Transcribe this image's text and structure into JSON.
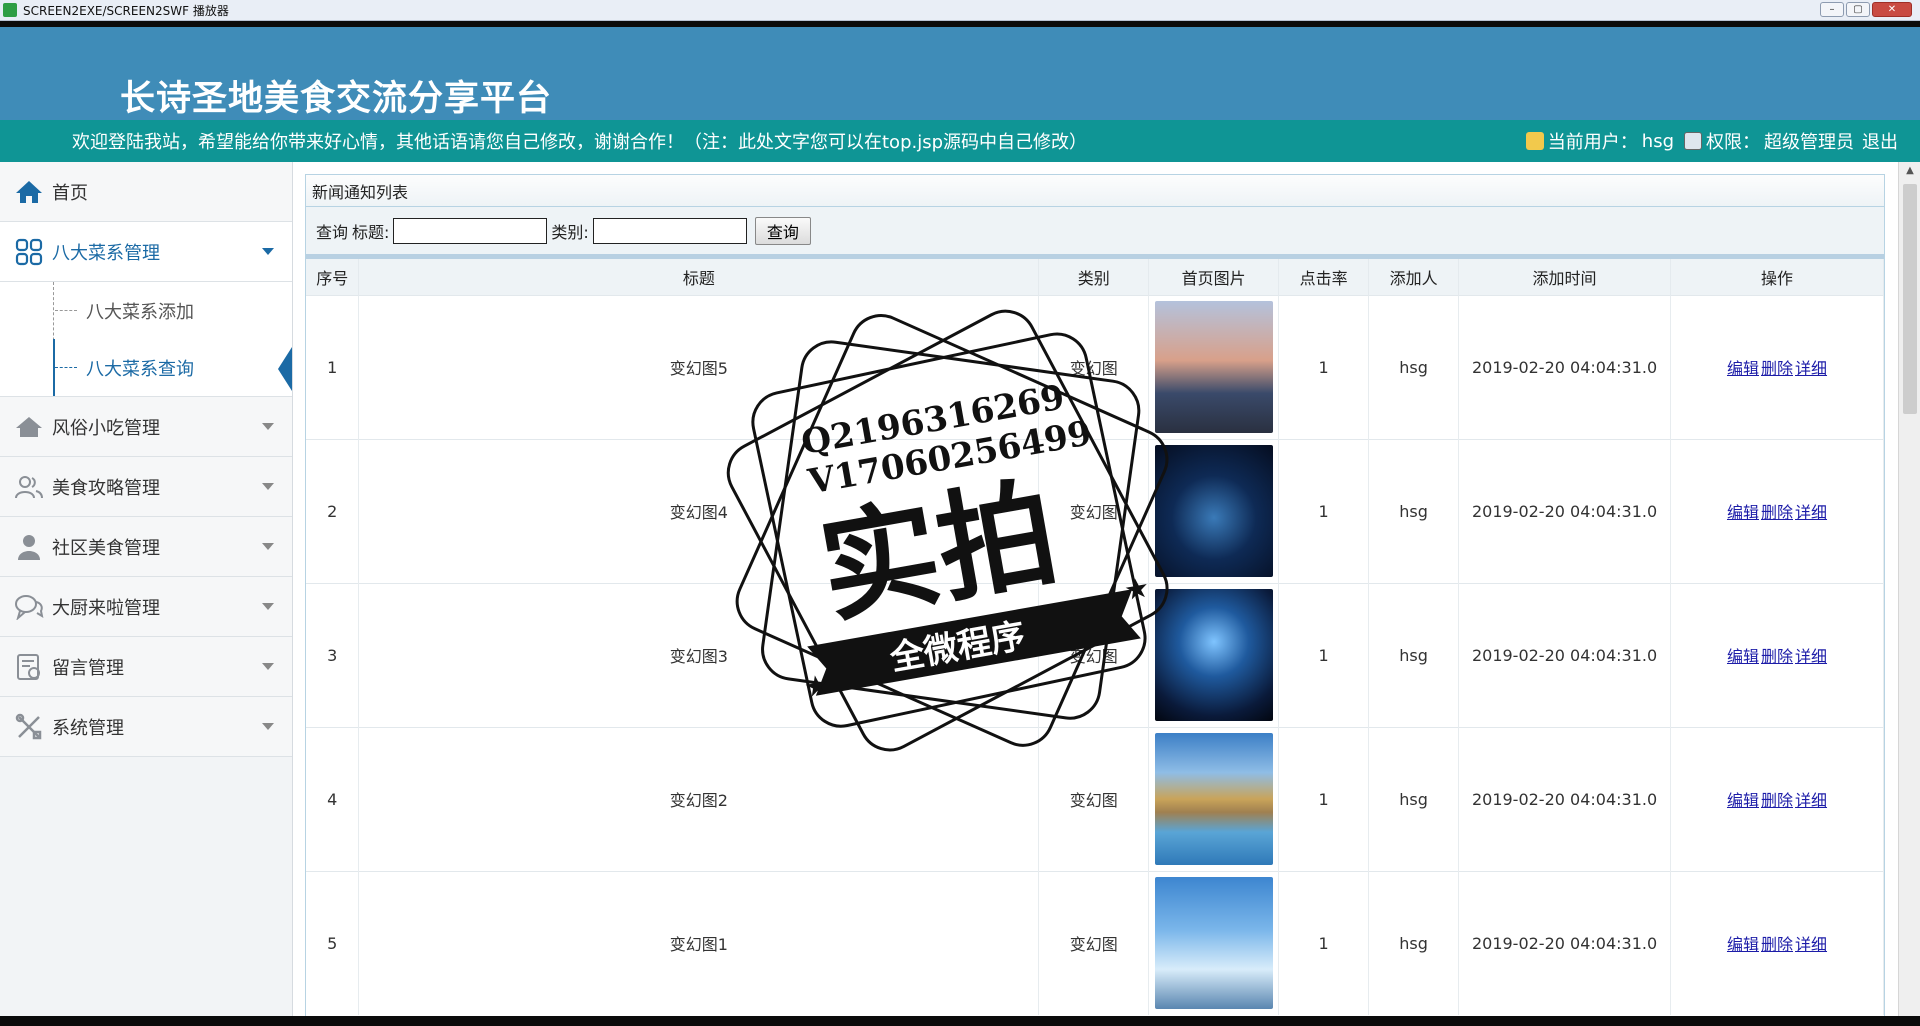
{
  "window": {
    "title": "SCREEN2EXE/SCREEN2SWF 播放器",
    "controls": [
      "–",
      "▢",
      "✕"
    ]
  },
  "header": {
    "site_title": "长诗圣地美食交流分享平台",
    "notice": "欢迎登陆我站，希望能给你带来好心情，其他话语请您自己修改，谢谢合作！（注：此处文字您可以在top.jsp源码中自己修改）",
    "current_user_label": "当前用户：",
    "current_user": "hsg",
    "permission_label": "权限：",
    "permission": "超级管理员",
    "logout": "退出"
  },
  "sidebar": {
    "home": "首页",
    "items": [
      {
        "label": "八大菜系管理",
        "icon": "grid-icon",
        "expanded": true,
        "children": [
          {
            "label": "八大菜系添加"
          },
          {
            "label": "八大菜系查询"
          }
        ]
      },
      {
        "label": "风俗小吃管理",
        "icon": "house-icon"
      },
      {
        "label": "美食攻略管理",
        "icon": "users-icon"
      },
      {
        "label": "社区美食管理",
        "icon": "person-icon"
      },
      {
        "label": "大厨来啦管理",
        "icon": "chat-icon"
      },
      {
        "label": "留言管理",
        "icon": "message-icon"
      },
      {
        "label": "系统管理",
        "icon": "tools-icon"
      }
    ]
  },
  "content": {
    "panel_title": "新闻通知列表",
    "search": {
      "prefix": "查询",
      "title_label": "标题:",
      "title_value": "",
      "category_label": "类别:",
      "category_value": "",
      "button": "查询"
    },
    "columns": [
      "序号",
      "标题",
      "类别",
      "首页图片",
      "点击率",
      "添加人",
      "添加时间",
      "操作"
    ],
    "rows": [
      {
        "no": "1",
        "title": "变幻图5",
        "category": "变幻图",
        "clicks": "1",
        "adder": "hsg",
        "time": "2019-02-20 04:04:31.0"
      },
      {
        "no": "2",
        "title": "变幻图4",
        "category": "变幻图",
        "clicks": "1",
        "adder": "hsg",
        "time": "2019-02-20 04:04:31.0"
      },
      {
        "no": "3",
        "title": "变幻图3",
        "category": "变幻图",
        "clicks": "1",
        "adder": "hsg",
        "time": "2019-02-20 04:04:31.0"
      },
      {
        "no": "4",
        "title": "变幻图2",
        "category": "变幻图",
        "clicks": "1",
        "adder": "hsg",
        "time": "2019-02-20 04:04:31.0"
      },
      {
        "no": "5",
        "title": "变幻图1",
        "category": "变幻图",
        "clicks": "1",
        "adder": "hsg",
        "time": "2019-02-20 04:04:31.0"
      }
    ],
    "ops": {
      "edit": "编辑",
      "delete": "删除",
      "detail": "详细"
    }
  },
  "watermark": {
    "line1": "Q2196316269",
    "line2": "V17060256499",
    "main": "实拍",
    "banner": "全微程序"
  },
  "colors": {
    "header_blue": "#3f8cb8",
    "notice_teal": "#0f9595",
    "accent": "#1b6aa5",
    "link": "#1c1ca8"
  }
}
